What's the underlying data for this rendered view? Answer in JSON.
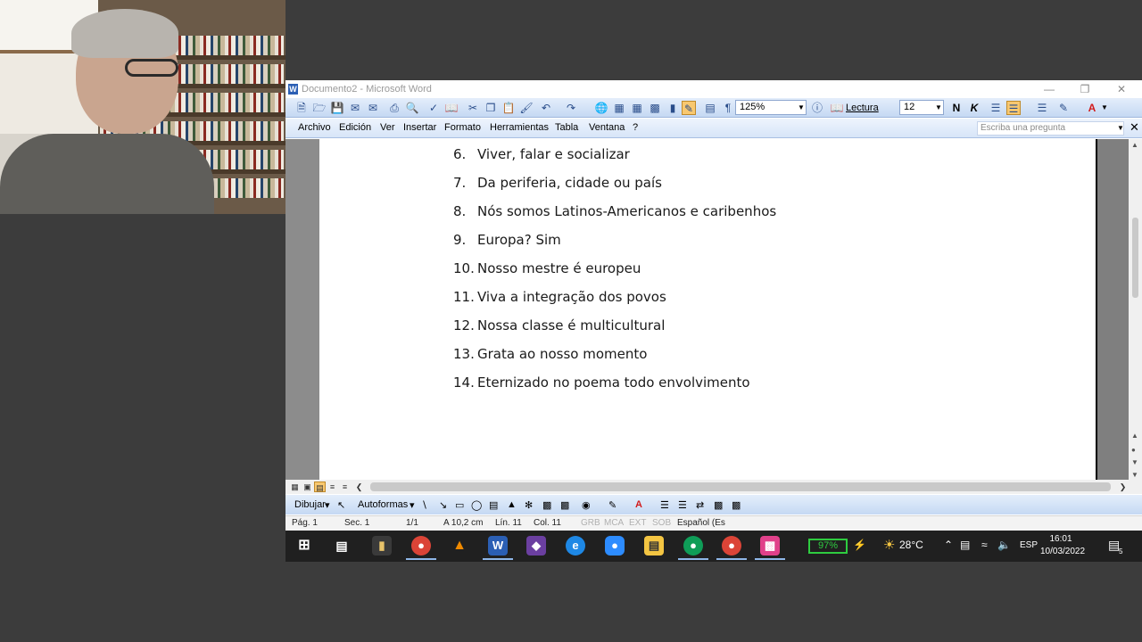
{
  "window": {
    "title": "Documento2 - Microsoft Word",
    "app_icon": "W"
  },
  "toolbar": {
    "zoom": "125%",
    "reading_label": "Lectura",
    "font_size": "12",
    "bold": "N",
    "italic": "K",
    "font_color_glyph": "A"
  },
  "menu": {
    "items": [
      "Archivo",
      "Edición",
      "Ver",
      "Insertar",
      "Formato",
      "Herramientas",
      "Tabla",
      "Ventana",
      "?"
    ],
    "ask_placeholder": "Escriba una pregunta"
  },
  "document": {
    "list": [
      {
        "num": "6.",
        "text": "Viver, falar e socializar"
      },
      {
        "num": "7.",
        "text": "Da periferia, cidade ou país"
      },
      {
        "num": "8.",
        "text": "Nós somos Latinos-Americanos e caribenhos"
      },
      {
        "num": "9.",
        "text": "Europa? Sim"
      },
      {
        "num": "10.",
        "text": "Nosso mestre é europeu"
      },
      {
        "num": "11.",
        "text": "Viva a integração dos povos"
      },
      {
        "num": "12.",
        "text": "Nossa classe é multicultural"
      },
      {
        "num": "13.",
        "text": "Grata ao nosso momento"
      },
      {
        "num": "14.",
        "text": "Eternizado no poema todo envolvimento"
      }
    ]
  },
  "drawbar": {
    "draw_label": "Dibujar",
    "autoshapes_label": "Autoformas"
  },
  "status": {
    "page": "Pág. 1",
    "section": "Sec. 1",
    "pages": "1/1",
    "at": "A 10,2 cm",
    "line": "Lín. 11",
    "col": "Col. 11",
    "grb": "GRB",
    "mca": "MCA",
    "ext": "EXT",
    "sob": "SOB",
    "language": "Español (Es"
  },
  "taskbar": {
    "battery": "97%",
    "temperature": "28°C",
    "lang": "ESP",
    "time": "16:01",
    "date": "10/03/2022",
    "notifications": "5"
  }
}
